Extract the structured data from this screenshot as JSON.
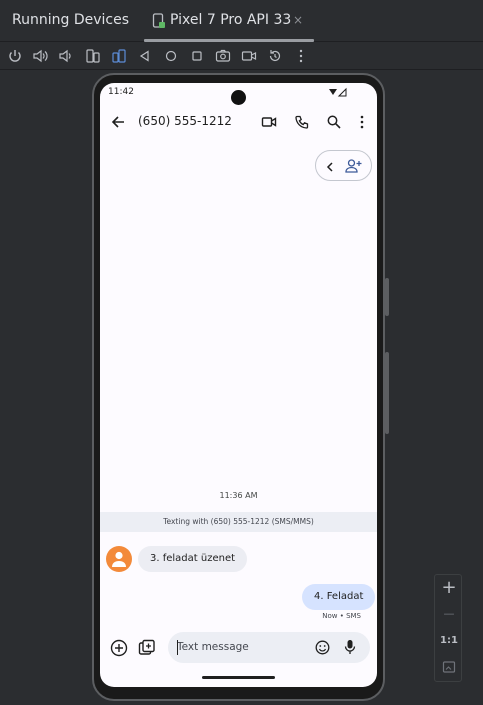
{
  "panel": {
    "title": "Running Devices",
    "device_tab": "Pixel 7 Pro API 33",
    "close_glyph": "×"
  },
  "toolbar": {
    "icons": [
      "power-icon",
      "volume-up-icon",
      "volume-down-icon",
      "rotate-left-icon",
      "rotate-right-icon",
      "back-icon",
      "home-icon",
      "overview-icon",
      "screenshot-icon",
      "screen-record-icon",
      "reset-icon",
      "more-vert-icon"
    ]
  },
  "device": {
    "status_time": "11:42",
    "contact": "(650) 555-1212",
    "timestamp": "11:36 AM",
    "texting_info": "Texting with (650) 555-1212 (SMS/MMS)",
    "incoming_message": "3. feladat üzenet",
    "outgoing_message": "4. Feladat",
    "outgoing_meta": "Now • SMS",
    "compose_placeholder": "Text message",
    "avatar_color": "#f38a3a",
    "outgoing_bubble_color": "#d6e3ff"
  },
  "zoom": {
    "plus": "+",
    "minus": "—",
    "actual": "1:1"
  }
}
